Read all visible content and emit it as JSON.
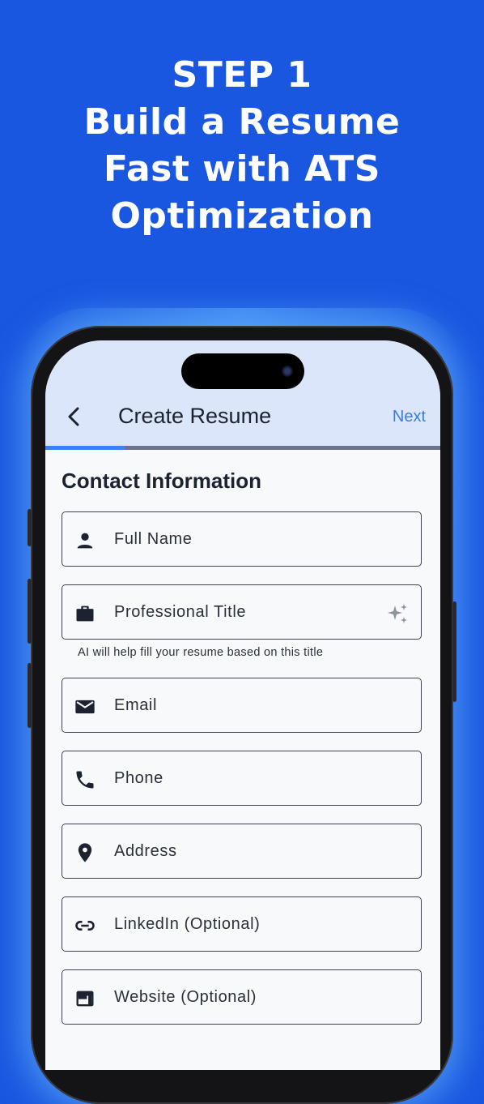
{
  "hero": {
    "lines": [
      "STEP 1",
      "Build a Resume",
      "Fast with ATS",
      "Optimization"
    ]
  },
  "app": {
    "title": "Create Resume",
    "back_icon": "chevron-left-icon",
    "next_label": "Next",
    "progress": 0.2
  },
  "form": {
    "section_title": "Contact Information",
    "fields": [
      {
        "label": "Full Name",
        "icon": "person-icon"
      },
      {
        "label": "Professional Title",
        "icon": "briefcase-icon",
        "trailing_icon": "sparkle-icon"
      },
      {
        "label": "Email",
        "icon": "mail-icon"
      },
      {
        "label": "Phone",
        "icon": "phone-icon"
      },
      {
        "label": "Address",
        "icon": "location-pin-icon"
      },
      {
        "label": "LinkedIn (Optional)",
        "icon": "link-icon"
      },
      {
        "label": "Website (Optional)",
        "icon": "web-icon"
      }
    ],
    "title_helper": "AI will help fill your resume based on this title"
  },
  "colors": {
    "background": "#1a57e0",
    "appbar": "#dbe6fb",
    "accent": "#3b82f6",
    "text": "#1c2230"
  }
}
